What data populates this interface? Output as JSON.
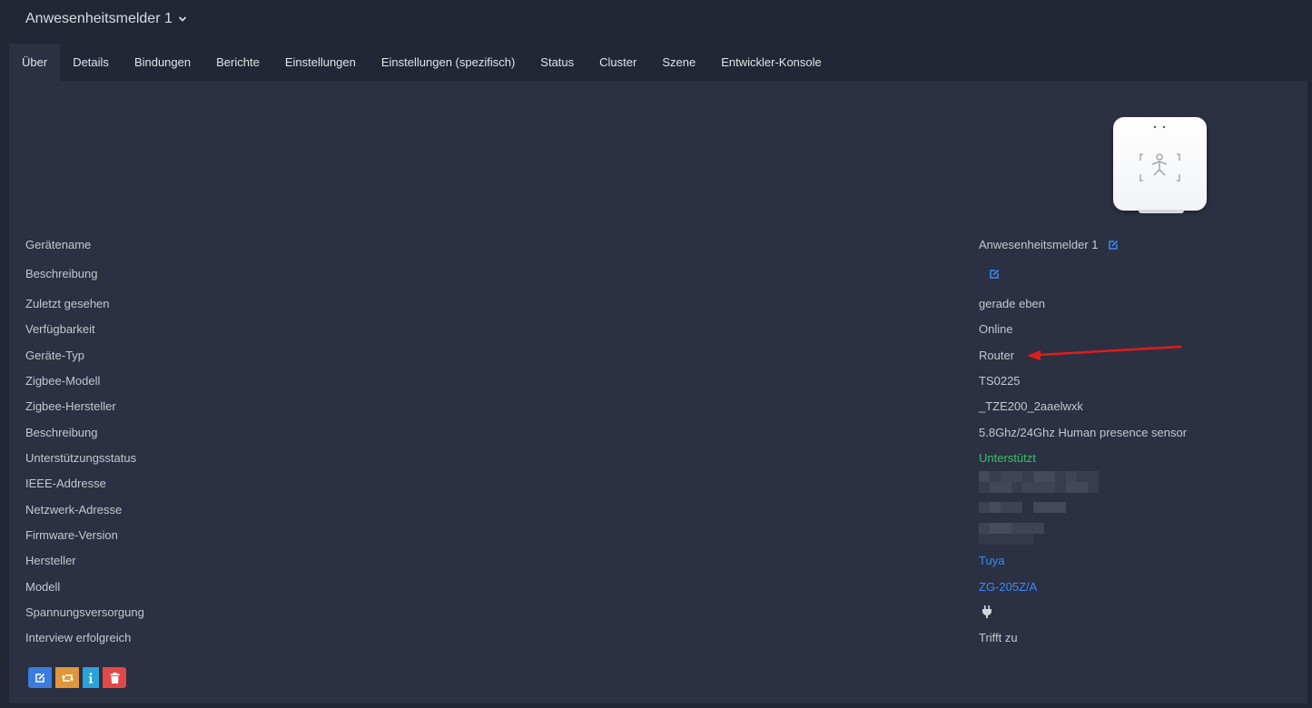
{
  "header": {
    "device_title": "Anwesenheitsmelder 1"
  },
  "tabs": [
    {
      "label": "Über",
      "active": true
    },
    {
      "label": "Details"
    },
    {
      "label": "Bindungen"
    },
    {
      "label": "Berichte"
    },
    {
      "label": "Einstellungen"
    },
    {
      "label": "Einstellungen (spezifisch)"
    },
    {
      "label": "Status"
    },
    {
      "label": "Cluster"
    },
    {
      "label": "Szene"
    },
    {
      "label": "Entwickler-Konsole"
    }
  ],
  "rows": [
    {
      "label": "Gerätename",
      "value": "Anwesenheitsmelder 1"
    },
    {
      "label": "Beschreibung",
      "value": ""
    },
    {
      "label": "Zuletzt gesehen",
      "value": "gerade eben"
    },
    {
      "label": "Verfügbarkeit",
      "value": "Online"
    },
    {
      "label": "Geräte-Typ",
      "value": "Router"
    },
    {
      "label": "Zigbee-Modell",
      "value": "TS0225"
    },
    {
      "label": "Zigbee-Hersteller",
      "value": "_TZE200_2aaelwxk"
    },
    {
      "label": "Beschreibung",
      "value": "5.8Ghz/24Ghz Human presence sensor"
    },
    {
      "label": "Unterstützungsstatus",
      "value": "Unterstützt"
    },
    {
      "label": "IEEE-Addresse",
      "value": ""
    },
    {
      "label": "Netzwerk-Adresse",
      "value": ""
    },
    {
      "label": "Firmware-Version",
      "value": ""
    },
    {
      "label": "Hersteller",
      "value": "Tuya"
    },
    {
      "label": "Modell",
      "value": "ZG-205Z/A"
    },
    {
      "label": "Spannungsversorgung",
      "value": ""
    },
    {
      "label": "Interview erfolgreich",
      "value": "Trifft zu"
    }
  ],
  "colors": {
    "background": "#222736",
    "panel": "#2b3042",
    "link": "#3d8af7",
    "supported": "#39c26a",
    "annotation_arrow": "#e01b1b"
  },
  "icons": {
    "title_dropdown": "chevron-down-icon",
    "edit": "edit-icon",
    "power": "plug-icon",
    "actions": [
      "edit-icon",
      "swap-icon",
      "info-icon",
      "trash-icon"
    ]
  }
}
